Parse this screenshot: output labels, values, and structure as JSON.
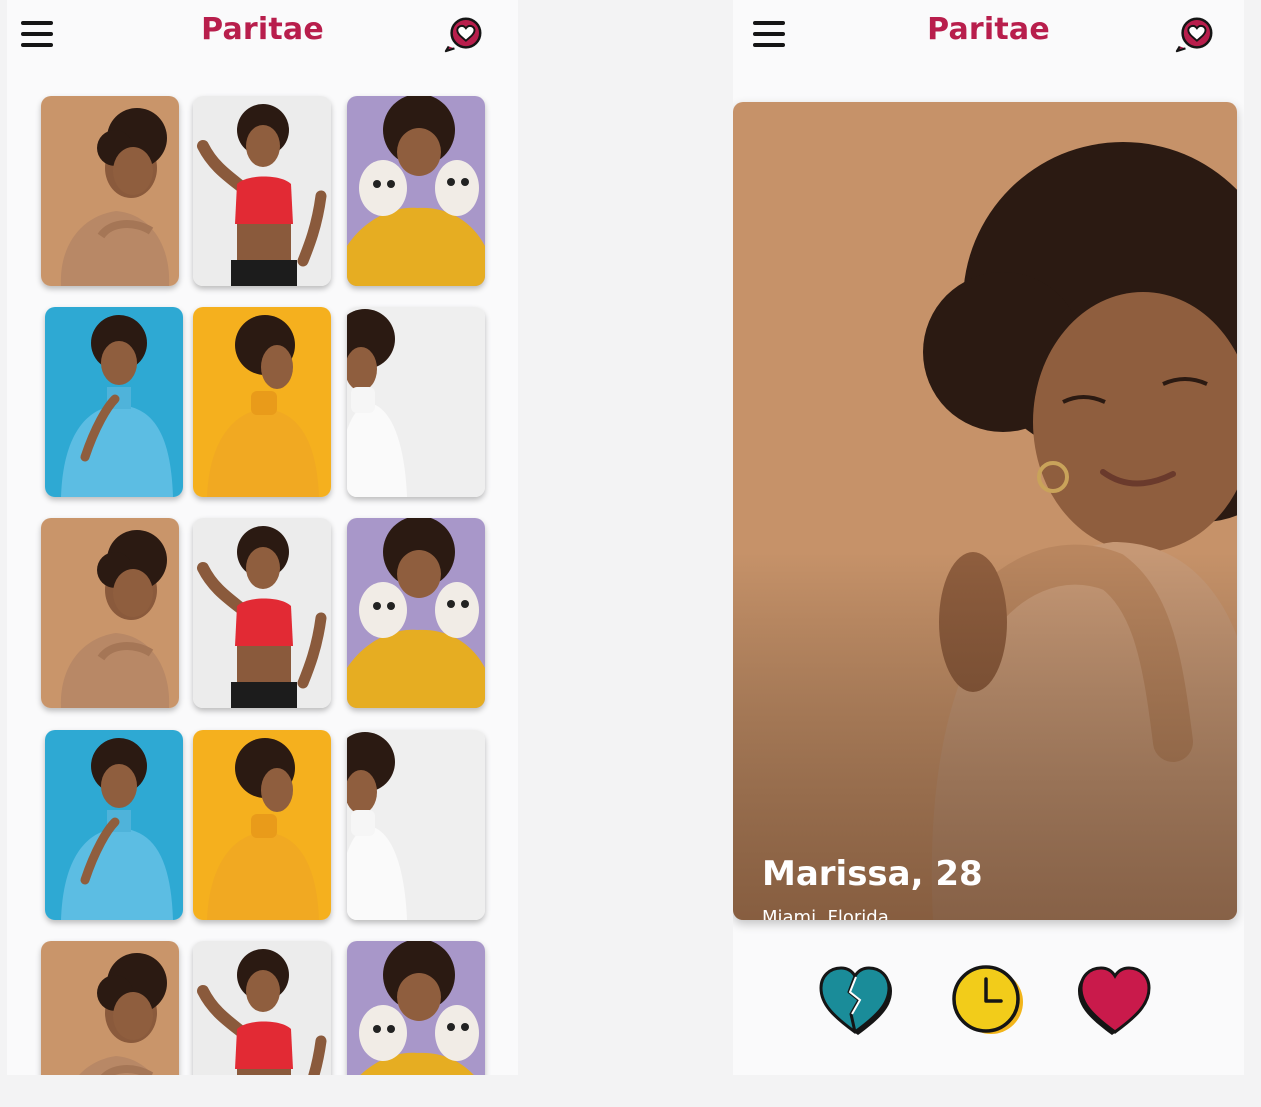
{
  "app": {
    "brand": "Paritae"
  },
  "colors": {
    "brand": "#b81e4c",
    "tan": "#c9956a",
    "teal": "#1a8c99",
    "yellow": "#f2cc1a",
    "crimson": "#c91a4b"
  },
  "grid_screen": {
    "menu_icon": "hamburger-icon",
    "chat_icon": "heart-chat-icon",
    "tiles": [
      {
        "photo": "tan-background-hug"
      },
      {
        "photo": "white-background-flex"
      },
      {
        "photo": "purple-background-puppies"
      },
      {
        "photo": "blue-background-turtleneck"
      },
      {
        "photo": "yellow-background-profile"
      },
      {
        "photo": "white-background-turtleneck"
      },
      {
        "photo": "tan-background-hug"
      },
      {
        "photo": "white-background-flex"
      },
      {
        "photo": "purple-background-puppies"
      },
      {
        "photo": "blue-background-turtleneck"
      },
      {
        "photo": "yellow-background-profile"
      },
      {
        "photo": "white-background-turtleneck"
      },
      {
        "photo": "tan-background-hug"
      },
      {
        "photo": "white-background-flex"
      },
      {
        "photo": "purple-background-puppies"
      }
    ]
  },
  "profile_screen": {
    "menu_icon": "hamburger-icon",
    "chat_icon": "heart-chat-icon",
    "profile": {
      "name_age": "Marissa, 28",
      "location": "Miami, Florida"
    },
    "actions": [
      {
        "icon": "broken-heart-icon"
      },
      {
        "icon": "clock-icon"
      },
      {
        "icon": "heart-icon"
      }
    ]
  }
}
